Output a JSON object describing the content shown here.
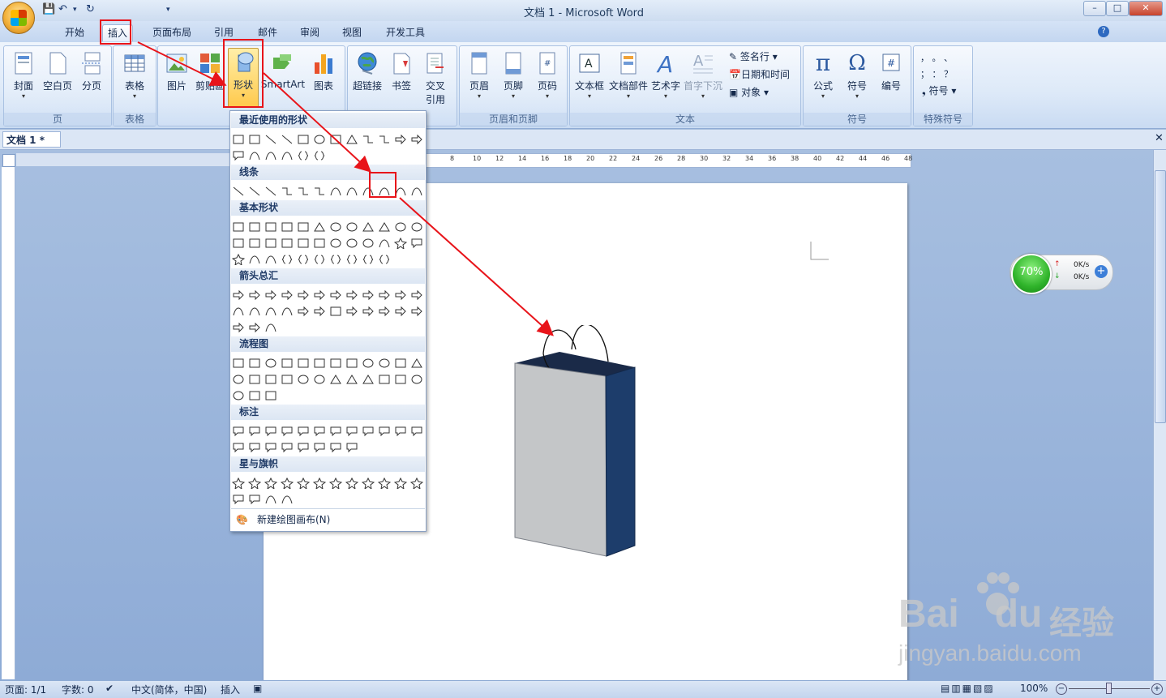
{
  "window": {
    "title": "文档 1 - Microsoft Word",
    "min": "–",
    "max": "□",
    "close": "✕"
  },
  "qat": {
    "save": "💾",
    "undo": "↶",
    "undo_dd": "▾",
    "redo": "↻",
    "customize": "▾"
  },
  "tabs": [
    "开始",
    "插入",
    "页面布局",
    "引用",
    "邮件",
    "审阅",
    "视图",
    "开发工具"
  ],
  "ribbon": {
    "pages": {
      "cover": "封面",
      "blank": "空白页",
      "break": "分页",
      "label": "页"
    },
    "tables": {
      "table": "表格",
      "label": "表格"
    },
    "illustrations": {
      "picture": "图片",
      "clipart": "剪贴画",
      "shapes": "形状",
      "smartart": "SmartArt",
      "chart": "图表"
    },
    "links": {
      "hyperlink": "超链接",
      "bookmark": "书签",
      "crossref_1": "交叉",
      "crossref_2": "引用"
    },
    "header_footer": {
      "header": "页眉",
      "footer": "页脚",
      "page_number": "页码",
      "label": "页眉和页脚"
    },
    "text": {
      "textbox": "文本框",
      "quickparts": "文档部件",
      "wordart": "艺术字",
      "dropcap": "首字下沉",
      "signature": "签名行",
      "datetime": "日期和时间",
      "object": "对象",
      "label": "文本"
    },
    "symbols": {
      "equation": "公式",
      "symbol": "符号",
      "numbering": "编号",
      "label": "符号"
    },
    "special": {
      "symbol": "符号",
      "label": "特殊符号",
      "row1": "，  。  、",
      "row2": "；  ：  ？"
    }
  },
  "doc_tab": "文档 1 *",
  "ruler_numbers": [
    "8",
    "10",
    "12",
    "14",
    "16",
    "18",
    "20",
    "22",
    "24",
    "26",
    "28",
    "30",
    "32",
    "34",
    "36",
    "38",
    "40",
    "42",
    "44",
    "46",
    "48"
  ],
  "shapes_menu": {
    "recent": "最近使用的形状",
    "lines": "线条",
    "basic": "基本形状",
    "arrows": "箭头总汇",
    "flowchart": "流程图",
    "callouts": "标注",
    "stars": "星与旗帜",
    "new_canvas": "新建绘图画布(N)"
  },
  "net_widget": {
    "percent": "70%",
    "up": "0K/s",
    "down": "0K/s"
  },
  "status": {
    "page": "页面: 1/1",
    "words": "字数: 0",
    "language": "中文(简体，中国)",
    "mode": "插入",
    "zoom": "100%"
  },
  "watermark": {
    "brand": "Bai",
    "brand2": "du",
    "cn": "经验",
    "url": "jingyan.baidu.com"
  },
  "colors": {
    "annotation": "#e8141a",
    "bag_front": "#c4c6c8",
    "bag_side": "#1d3d6b"
  }
}
